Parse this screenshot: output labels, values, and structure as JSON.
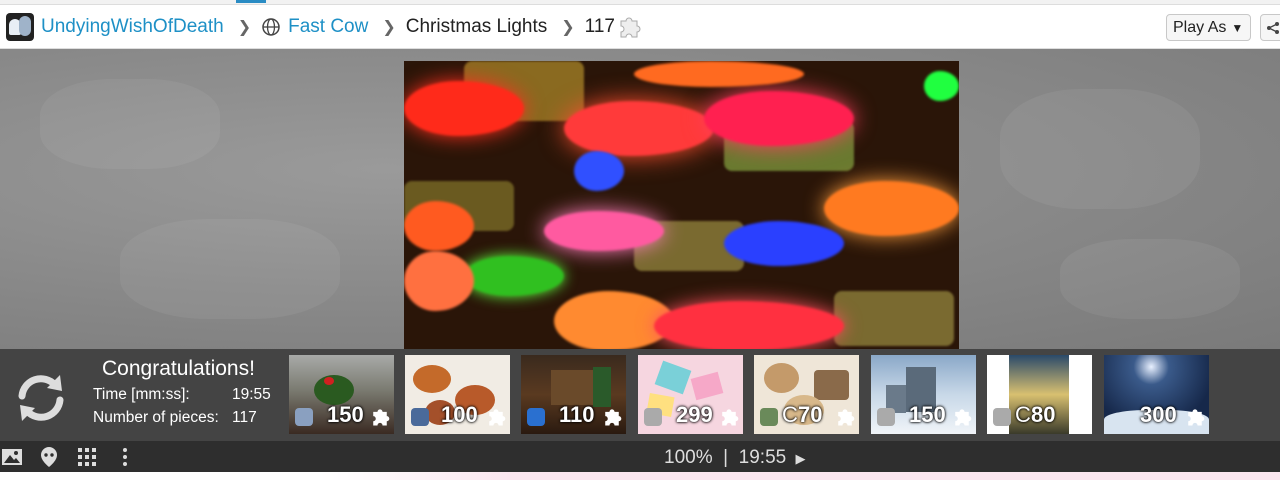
{
  "header": {
    "user": "UndyingWishOfDeath",
    "category": "Fast Cow",
    "puzzle_title": "Christmas Lights",
    "piece_count": "117",
    "play_as_label": "Play As"
  },
  "result": {
    "title": "Congratulations!",
    "time_label": "Time [mm:ss]:",
    "time_value": "19:55",
    "pieces_label": "Number of pieces:",
    "pieces_value": "117"
  },
  "suggestions": [
    {
      "count": "150",
      "badge": "user-icon"
    },
    {
      "count": "100",
      "badge": "gear-icon"
    },
    {
      "count": "110",
      "badge": "heart-icon"
    },
    {
      "count": "299",
      "badge": "rotate-icon"
    },
    {
      "count": "70",
      "badge": "frame-icon",
      "prefix": "C"
    },
    {
      "count": "150",
      "badge": "user-icon"
    },
    {
      "count": "80",
      "badge": "user-icon",
      "prefix": "C"
    },
    {
      "count": "300",
      "badge": "none"
    }
  ],
  "status": {
    "zoom": "100%",
    "separator": "|",
    "timer": "19:55"
  },
  "colors": {
    "link": "#1e90c6",
    "panel": "#444444",
    "bottom_bar": "#2e2e2e"
  }
}
